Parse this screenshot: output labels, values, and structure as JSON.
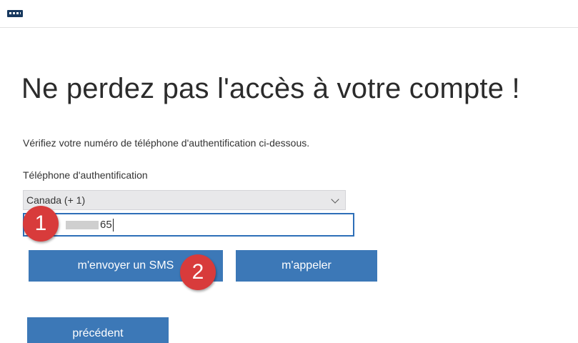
{
  "page": {
    "title": "Ne perdez pas l'accès à votre compte !",
    "description": "Vérifiez votre numéro de téléphone d'authentification ci-dessous."
  },
  "form": {
    "phone_label": "Téléphone d'authentification",
    "country_selected": "Canada (+ 1)",
    "phone_value_visible": "65"
  },
  "buttons": {
    "sms": "m'envoyer un SMS",
    "call": "m'appeler",
    "back": "précédent"
  },
  "annotations": {
    "step1": "1",
    "step2": "2"
  },
  "colors": {
    "button": "#3c78b7",
    "input_focus_border": "#2e6fb8",
    "marker": "#d83b3b"
  },
  "icons": {
    "logo": "logo-icon",
    "dropdown": "chevron-down-icon"
  }
}
